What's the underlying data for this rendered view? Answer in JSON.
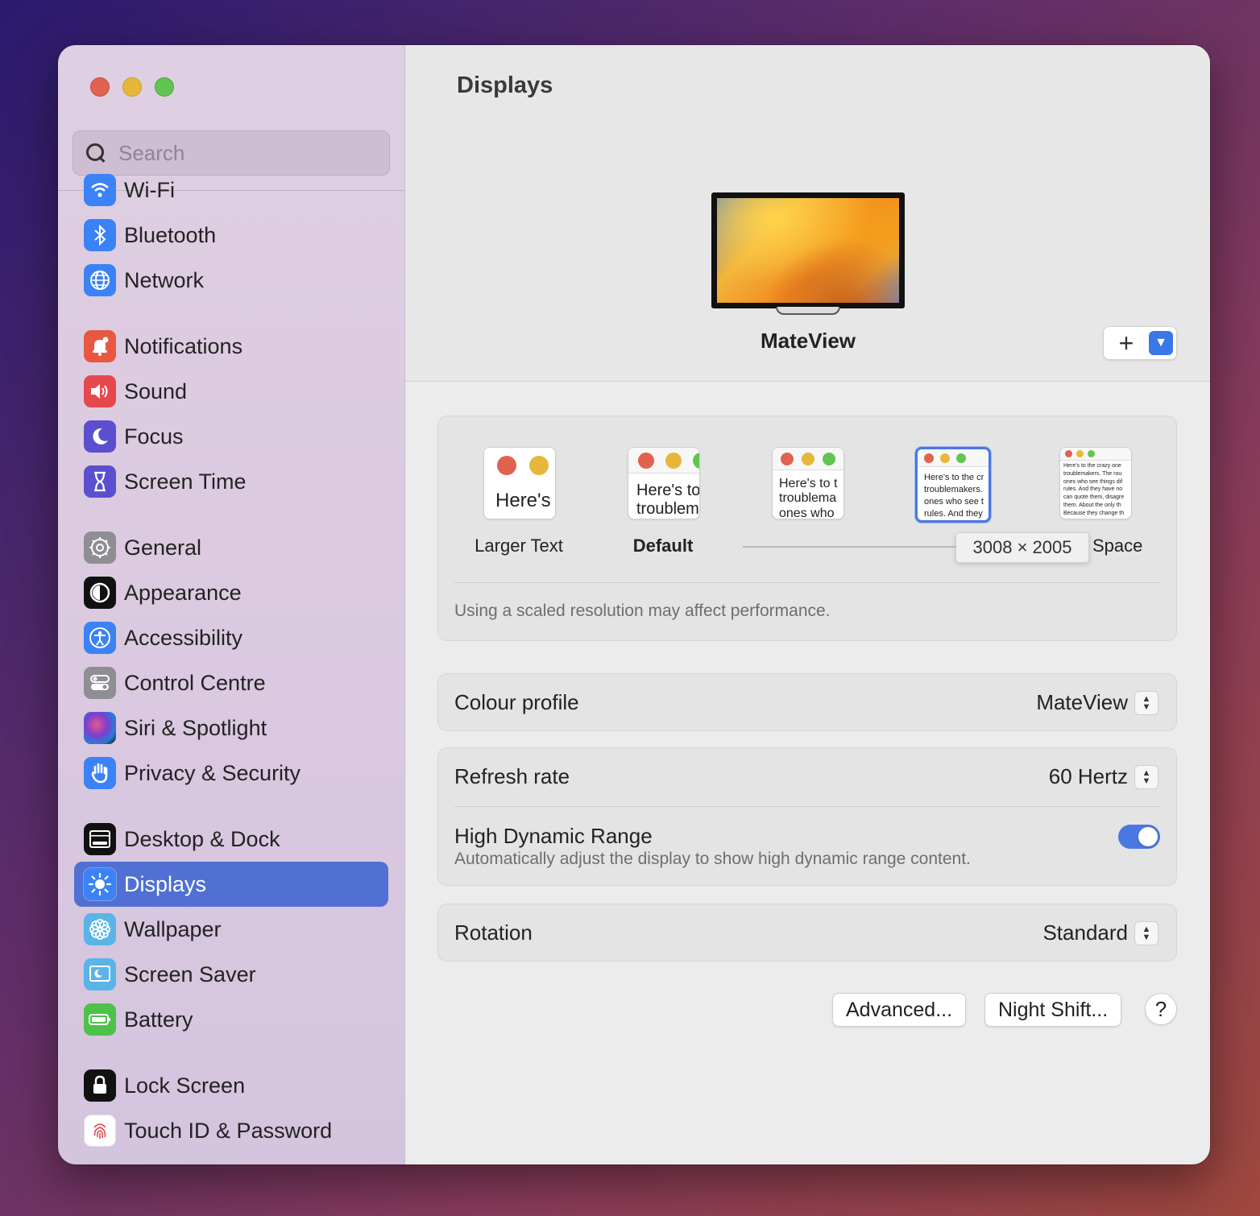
{
  "window": {
    "title": "Displays"
  },
  "search": {
    "placeholder": "Search"
  },
  "sidebar": {
    "items": [
      {
        "label": "Wi-Fi",
        "icon": "wifi-icon",
        "color": "#3b82f6"
      },
      {
        "label": "Bluetooth",
        "icon": "bluetooth-icon",
        "color": "#3b82f6"
      },
      {
        "label": "Network",
        "icon": "globe-icon",
        "color": "#3b82f6"
      },
      {
        "label": "Notifications",
        "icon": "bell-icon",
        "color": "#e8573f"
      },
      {
        "label": "Sound",
        "icon": "speaker-icon",
        "color": "#e5484d"
      },
      {
        "label": "Focus",
        "icon": "moon-icon",
        "color": "#5b4fd0"
      },
      {
        "label": "Screen Time",
        "icon": "hourglass-icon",
        "color": "#5b4fd0"
      },
      {
        "label": "General",
        "icon": "gear-icon",
        "color": "#8e8e93"
      },
      {
        "label": "Appearance",
        "icon": "appearance-icon",
        "color": "#111111"
      },
      {
        "label": "Accessibility",
        "icon": "accessibility-icon",
        "color": "#3b82f6"
      },
      {
        "label": "Control Centre",
        "icon": "control-centre-icon",
        "color": "#8e8e93"
      },
      {
        "label": "Siri & Spotlight",
        "icon": "siri-icon",
        "color": "#222222"
      },
      {
        "label": "Privacy & Security",
        "icon": "hand-icon",
        "color": "#3b82f6"
      },
      {
        "label": "Desktop & Dock",
        "icon": "dock-icon",
        "color": "#111111"
      },
      {
        "label": "Displays",
        "icon": "sun-icon",
        "color": "#3b82f6"
      },
      {
        "label": "Wallpaper",
        "icon": "flower-icon",
        "color": "#5ab4e8"
      },
      {
        "label": "Screen Saver",
        "icon": "screen-saver-icon",
        "color": "#5ab4e8"
      },
      {
        "label": "Battery",
        "icon": "battery-icon",
        "color": "#4cc24a"
      },
      {
        "label": "Lock Screen",
        "icon": "lock-icon",
        "color": "#111111"
      },
      {
        "label": "Touch ID & Password",
        "icon": "fingerprint-icon",
        "color": "#ffffff"
      }
    ],
    "active": "Displays"
  },
  "display": {
    "name": "MateView"
  },
  "resolution": {
    "options": [
      {
        "label": "Larger Text",
        "preview": "Here's"
      },
      {
        "label": "Default",
        "preview": "Here's to troublem"
      },
      {
        "label": "",
        "preview": "Here's to t troublema ones who"
      },
      {
        "label": "",
        "preview": "Here's to the cr troublemakers. ones who see t rules. And they"
      },
      {
        "label": "Space",
        "preview": "Here's to the crazy one troublemakers. The rou ones who see things dif rules. And they have no can quote them, disagre them. About the only th Because they change th"
      }
    ],
    "tooltip": "3008 × 2005",
    "note": "Using a scaled resolution may affect performance."
  },
  "settings": {
    "colour_profile": {
      "label": "Colour profile",
      "value": "MateView"
    },
    "refresh_rate": {
      "label": "Refresh rate",
      "value": "60 Hertz"
    },
    "hdr": {
      "label": "High Dynamic Range",
      "description": "Automatically adjust the display to show high dynamic range content.",
      "enabled": true
    },
    "rotation": {
      "label": "Rotation",
      "value": "Standard"
    }
  },
  "buttons": {
    "advanced": "Advanced...",
    "night_shift": "Night Shift...",
    "help": "?"
  },
  "colors": {
    "accent": "#4a78e0",
    "selection": "#5070d4"
  }
}
